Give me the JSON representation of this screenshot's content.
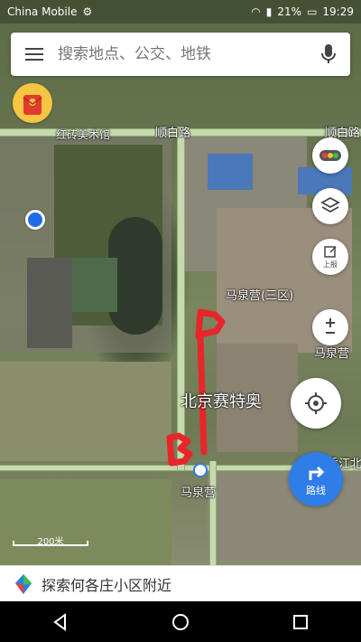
{
  "status": {
    "carrier": "China Mobile",
    "battery": "21%",
    "time": "19:29"
  },
  "search": {
    "placeholder": "搜索地点、公交、地铁"
  },
  "map": {
    "labels": {
      "gallery": "红砖美术馆",
      "road_left": "顺白路",
      "road_right": "顺白路",
      "district": "马泉营(三区)",
      "district_right": "马泉营",
      "school": "北京赛特奥",
      "station": "马泉营",
      "road_bottom": "香江北"
    },
    "annotations": {
      "p_mark": "P",
      "b_mark": "B"
    },
    "route_color": "#e8252b"
  },
  "tools": {
    "traffic": "traffic-icon",
    "layers": "layers-icon",
    "report_label": "上报",
    "route_label": "路线"
  },
  "scale": {
    "label": "200米"
  },
  "bottom": {
    "hint": "探索何各庄小区附近"
  }
}
